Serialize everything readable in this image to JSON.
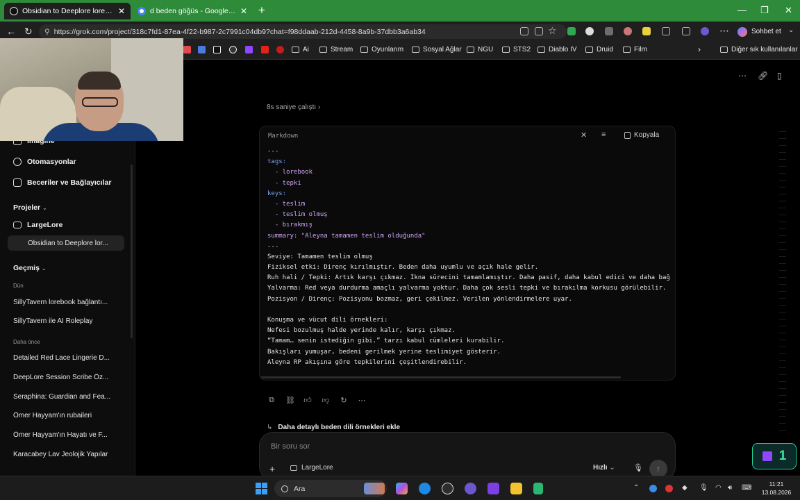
{
  "browser": {
    "tabs": [
      {
        "title": "Obsidian to Deeplore lore conversion",
        "active": true
      },
      {
        "title": "d beden göğüs - Google'da Ara",
        "active": false
      }
    ],
    "url": "https://grok.com/project/318c7fd1-87ea-4f22-b987-2c7991c04db9?chat=f98ddaab-212d-4458-8a9b-37dbb3a6ab34",
    "chat_button_label": "Sohbet et",
    "bookmarks": [
      "Ai",
      "Stream",
      "Oyunlarım",
      "Sosyal Ağlar",
      "NGU",
      "STS2",
      "Diablo IV",
      "Druid",
      "Film"
    ],
    "other_bookmarks_label": "Diğer sık kullanılanlar"
  },
  "sidebar": {
    "items": [
      {
        "label": "Imagine",
        "icon": "image-icon"
      },
      {
        "label": "Otomasyonlar",
        "icon": "automation-icon"
      },
      {
        "label": "Beceriler ve Bağlayıcılar",
        "icon": "skills-icon"
      }
    ],
    "projects_heading": "Projeler",
    "project_name": "LargeLore",
    "active_chat": "Obsidian to Deeplore lor...",
    "history_heading": "Geçmiş",
    "yesterday_label": "Dün",
    "yesterday": [
      "SillyTavern lorebook bağlantı...",
      "SillyTavern ile AI Roleplay"
    ],
    "earlier_label": "Daha önce",
    "earlier": [
      "Detailed Red Lace Lingerie D...",
      "DeepLore Session Scribe Öz...",
      "Seraphina: Guardian and Fea...",
      "Ömer Hayyam'ın rubaileri",
      "Ömer Hayyam'ın Hayatı ve F...",
      "Karacabey Lav Jeolojik Yapılar"
    ]
  },
  "main": {
    "thought_label": "8s saniye çalıştı",
    "code_language": "Markdown",
    "copy_label": "Kopyala",
    "code_lines": [
      {
        "t": "---",
        "k": "dim"
      },
      {
        "t": "tags:",
        "k": "key"
      },
      {
        "t": "  - lorebook",
        "k": "li"
      },
      {
        "t": "  - tepki",
        "k": "li"
      },
      {
        "t": "keys:",
        "k": "key"
      },
      {
        "t": "  - teslim",
        "k": "li"
      },
      {
        "t": "  - teslim olmuş",
        "k": "li"
      },
      {
        "t": "  - bırakmış",
        "k": "li"
      },
      {
        "t": "summary: \"Aleyna tamamen teslim olduğunda\"",
        "k": "li"
      },
      {
        "t": "---",
        "k": "dim"
      },
      {
        "t": "Seviye: Tamamen teslim olmuş",
        "k": ""
      },
      {
        "t": "Fiziksel etki: Direnç kırılmıştır. Beden daha uyumlu ve açık hale gelir.",
        "k": ""
      },
      {
        "t": "Ruh hali / Tepki: Artık karşı çıkmaz. İkna sürecini tamamlamıştır. Daha pasif, daha kabul edici ve daha bağ",
        "k": ""
      },
      {
        "t": "Yalvarma: Red veya durdurma amaçlı yalvarma yoktur. Daha çok sesli tepki ve bırakılma korkusu görülebilir.",
        "k": ""
      },
      {
        "t": "Pozisyon / Direnç: Pozisyonu bozmaz, geri çekilmez. Verilen yönlendirmelere uyar.",
        "k": ""
      },
      {
        "t": "",
        "k": ""
      },
      {
        "t": "Konuşma ve vücut dili örnekleri:",
        "k": ""
      },
      {
        "t": "Nefesi bozulmuş halde yerinde kalır, karşı çıkmaz.",
        "k": ""
      },
      {
        "t": "“Tamam… senin istediğin gibi.” tarzı kabul cümleleri kurabilir.",
        "k": ""
      },
      {
        "t": "Bakışları yumuşar, bedeni gerilmek yerine teslimiyet gösterir.",
        "k": ""
      },
      {
        "t": "Aleyna RP akışına göre tepkilerini çeşitlendirebilir.",
        "k": ""
      }
    ],
    "suggestion": "Daha detaylı beden dili örnekleri ekle",
    "composer": {
      "placeholder": "Bir soru sor",
      "project_chip": "LargeLore",
      "speed_label": "Hızlı"
    }
  },
  "overlay": {
    "twitch_count": "1"
  },
  "taskbar": {
    "search_label": "Ara",
    "time": "11:21",
    "date": "13.08.2026"
  },
  "colors": {
    "tabbar": "#2e8b3a",
    "accent_key": "#7aa2f7",
    "accent_value": "#d0a4f4",
    "twitch": "#3be3a8"
  }
}
